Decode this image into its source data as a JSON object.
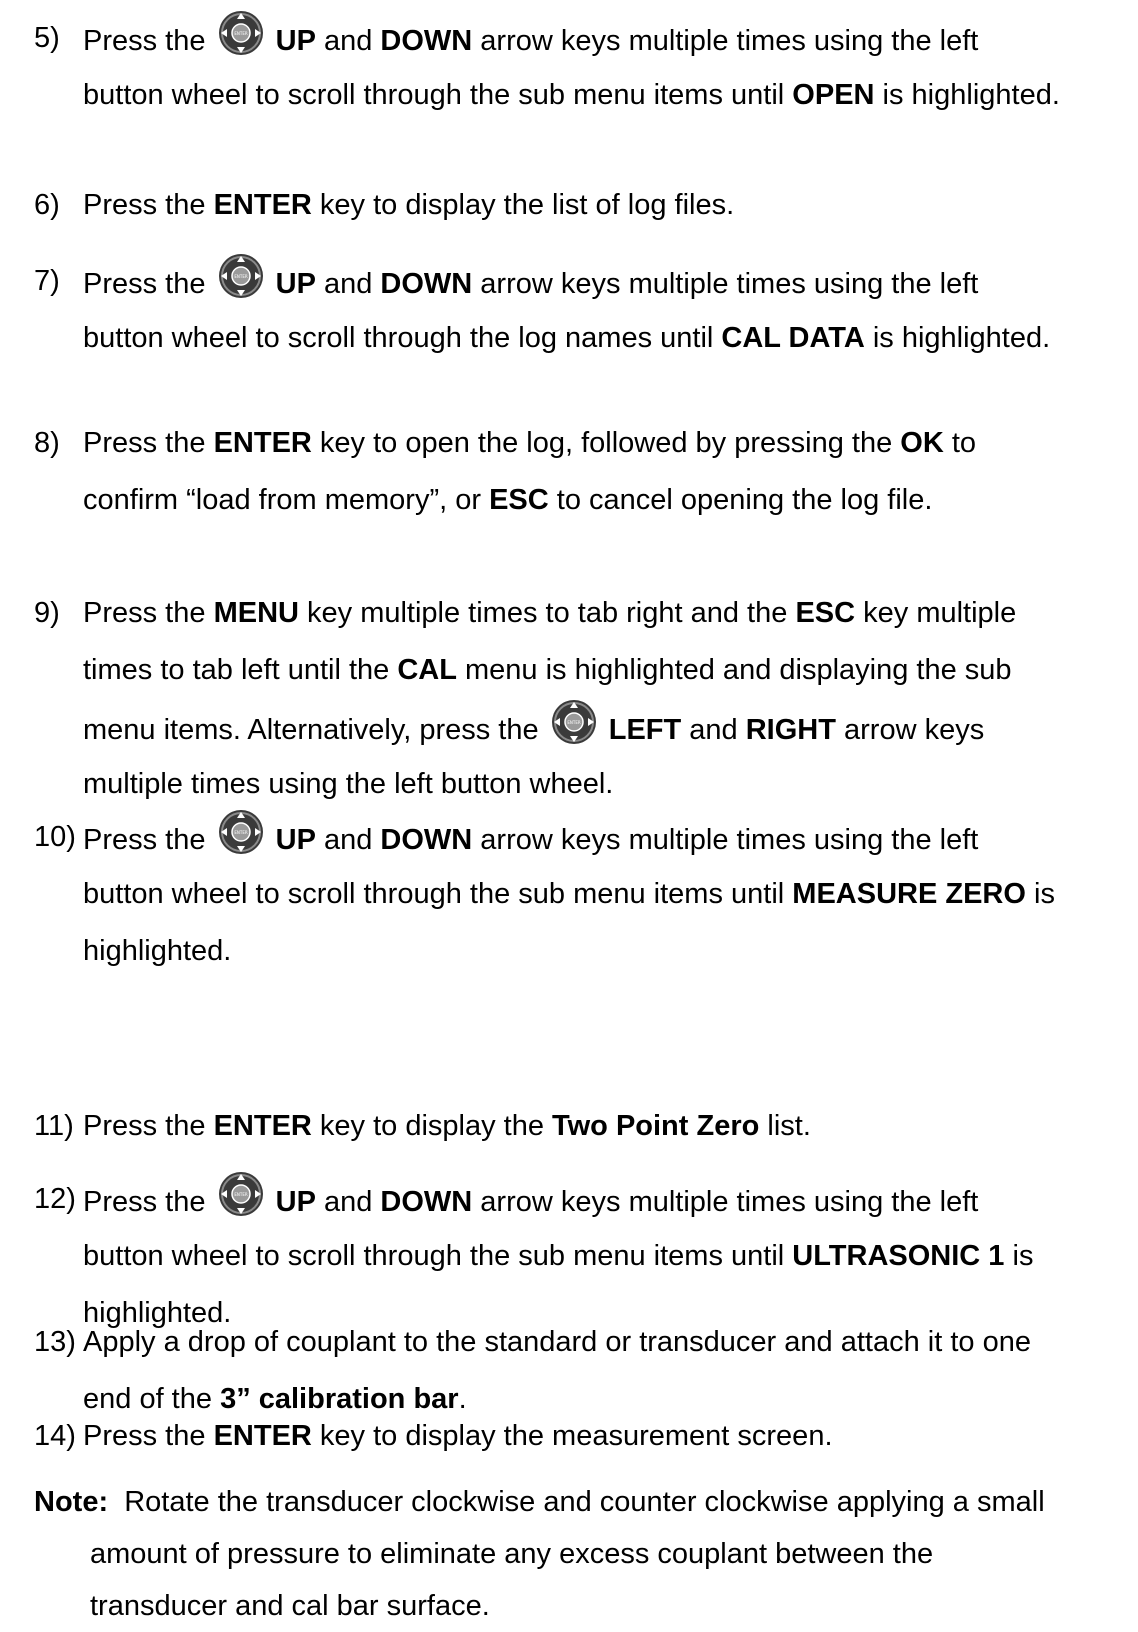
{
  "steps": [
    {
      "num": "5)",
      "lines": [
        [
          "Press the ",
          "@icon",
          " ",
          "**UP",
          " and ",
          "**DOWN",
          " arrow keys multiple times using the left"
        ],
        [
          "button wheel to scroll through the sub menu items until ",
          "**OPEN",
          " is highlighted."
        ]
      ]
    },
    {
      "num": "6)",
      "lines": [
        [
          "Press the ",
          "**ENTER",
          " key to display the list of log files."
        ]
      ]
    },
    {
      "num": "7)",
      "lines": [
        [
          "Press the ",
          "@icon",
          " ",
          "**UP",
          " and ",
          "**DOWN",
          " arrow keys multiple times using the left"
        ],
        [
          "button wheel to scroll through the log names until ",
          "**CAL DATA",
          " is highlighted."
        ]
      ]
    },
    {
      "num": "8)",
      "lines": [
        [
          "Press the ",
          "**ENTER",
          " key to open the log, followed by pressing the ",
          "**OK",
          " to"
        ],
        [
          "confirm “load from memory”, or ",
          "**ESC",
          " to cancel opening the log file."
        ]
      ]
    },
    {
      "num": "9)",
      "lines": [
        [
          "Press the ",
          "**MENU",
          " key multiple times to tab right and the ",
          "**ESC",
          " key multiple"
        ],
        [
          "times to tab left until the ",
          "**CAL",
          " menu is highlighted and displaying the sub"
        ],
        [
          "menu items.  Alternatively, press the  ",
          "@icon",
          " ",
          "**LEFT",
          " and ",
          "**RIGHT",
          " arrow keys"
        ],
        [
          "multiple times using the left button wheel."
        ]
      ]
    },
    {
      "num": "10)",
      "lines": [
        [
          "Press the ",
          "@icon",
          " ",
          "**UP",
          " and ",
          "**DOWN",
          " arrow keys multiple times using the left"
        ],
        [
          "button wheel to scroll through the sub menu items until ",
          "**MEASURE ZERO",
          " is"
        ],
        [
          "highlighted."
        ]
      ]
    },
    {
      "num": "11)",
      "lines": [
        [
          "Press the ",
          "**ENTER",
          " key to display the ",
          "**Two Point Zero",
          " list."
        ]
      ]
    },
    {
      "num": "12)",
      "lines": [
        [
          "Press the ",
          "@icon",
          " ",
          "**UP",
          " and ",
          "**DOWN",
          " arrow keys multiple times using the left"
        ],
        [
          "button wheel to scroll through the sub menu items until ",
          "**ULTRASONIC 1",
          " is"
        ],
        [
          "highlighted."
        ]
      ]
    },
    {
      "num": "13)",
      "lines": [
        [
          "Apply a drop of couplant to the standard or transducer and attach it to one"
        ],
        [
          "end of the ",
          "**3” calibration bar",
          "."
        ]
      ]
    },
    {
      "num": "14)",
      "lines": [
        [
          "Press the ",
          "**ENTER",
          " key to display the measurement screen."
        ]
      ]
    }
  ],
  "note": {
    "label": "Note:",
    "lines": [
      "Rotate the transducer clockwise and counter clockwise applying a small",
      "amount of pressure to eliminate any excess couplant between the",
      "transducer and cal bar surface."
    ]
  },
  "icon": {
    "name": "button-wheel-icon",
    "center_label": "ENTER",
    "colors": {
      "ring": "#3a3a3a",
      "ring_light": "#8a8a8a",
      "center": "#9a9a9a",
      "arrow": "#ffffff"
    }
  }
}
